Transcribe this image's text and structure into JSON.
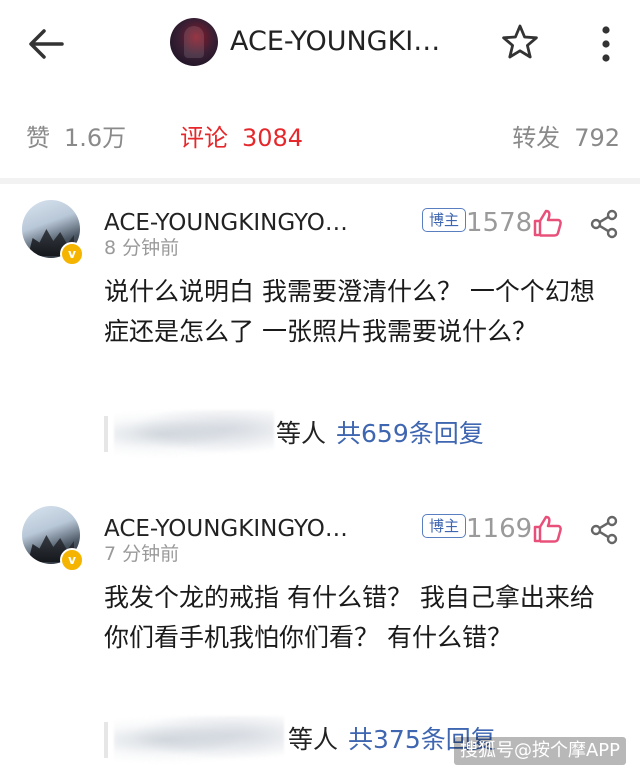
{
  "header": {
    "title": "ACE-YOUNGKI…",
    "back_icon": "arrow-left-icon",
    "star_icon": "star-outline-icon",
    "more_icon": "more-vertical-icon"
  },
  "stats": {
    "like_label": "赞",
    "like_value": "1.6万",
    "comment_label": "评论",
    "comment_value": "3084",
    "repost_label": "转发",
    "repost_value": "792",
    "active_color": "#e5282c"
  },
  "comments": [
    {
      "name": "ACE-YOUNGKINGYO…",
      "time": "8 分钟前",
      "author_tag": "博主",
      "likes": "1578",
      "text": "说什么说明白 我需要澄清什么？ 一个个幻想症还是怎么了 一张照片我需要说什么？",
      "reply_who": "等人",
      "reply_link": "共659条回复"
    },
    {
      "name": "ACE-YOUNGKINGYO…",
      "time": "7 分钟前",
      "author_tag": "博主",
      "likes": "1169",
      "text": "我发个龙的戒指 有什么错？ 我自己拿出来给你们看手机我怕你们看？ 有什么错？",
      "reply_who": "等人",
      "reply_link": "共375条回复"
    }
  ],
  "watermark": "搜狐号@按个摩APP",
  "colors": {
    "link_blue": "#3f66b0",
    "like_pink": "#e8507a",
    "badge_gold": "#f4b400"
  }
}
